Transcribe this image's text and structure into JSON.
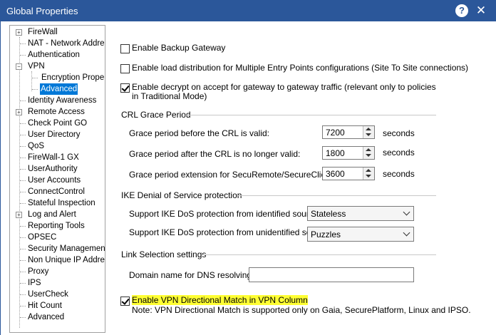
{
  "window": {
    "title": "Global Properties",
    "help_glyph": "?",
    "close_glyph": "✕"
  },
  "tree": {
    "items": [
      {
        "label": "FireWall",
        "expander": "+"
      },
      {
        "label": "NAT - Network Address Translation"
      },
      {
        "label": "Authentication"
      },
      {
        "label": "VPN",
        "expander": "−"
      },
      {
        "label": "Encryption Properties"
      },
      {
        "label": "Advanced",
        "selected": true
      },
      {
        "label": "Identity Awareness"
      },
      {
        "label": "Remote Access",
        "expander": "+"
      },
      {
        "label": "Check Point GO"
      },
      {
        "label": "User Directory"
      },
      {
        "label": "QoS"
      },
      {
        "label": "FireWall-1 GX"
      },
      {
        "label": "UserAuthority"
      },
      {
        "label": "User Accounts"
      },
      {
        "label": "ConnectControl"
      },
      {
        "label": "Stateful Inspection"
      },
      {
        "label": "Log and Alert",
        "expander": "+"
      },
      {
        "label": "Reporting Tools"
      },
      {
        "label": "OPSEC"
      },
      {
        "label": "Security Management Access"
      },
      {
        "label": "Non Unique IP Address Ranges"
      },
      {
        "label": "Proxy"
      },
      {
        "label": "IPS"
      },
      {
        "label": "UserCheck"
      },
      {
        "label": "Hit Count"
      },
      {
        "label": "Advanced"
      }
    ]
  },
  "panel": {
    "backup_gateway": {
      "label": "Enable Backup Gateway",
      "checked": false
    },
    "load_distribution": {
      "label": "Enable load distribution for Multiple Entry Points configurations (Site To Site connections)",
      "checked": false
    },
    "decrypt_accept": {
      "label_line1": "Enable decrypt on accept for gateway to gateway traffic (relevant only to policies",
      "label_line2": "in Traditional Mode)",
      "checked": true
    },
    "crl": {
      "title": "CRL Grace Period",
      "rows": [
        {
          "label": "Grace period before the CRL is valid:",
          "value": "7200",
          "unit": "seconds"
        },
        {
          "label": "Grace period after the CRL is no longer valid:",
          "value": "1800",
          "unit": "seconds"
        },
        {
          "label": "Grace period extension for SecuRemote/SecureClient:",
          "value": "3600",
          "unit": "seconds"
        }
      ]
    },
    "ike": {
      "title": "IKE Denial of Service protection",
      "identified": {
        "label": "Support IKE DoS protection from identified source",
        "value": "Stateless"
      },
      "unidentified": {
        "label": "Support IKE DoS protection from unidentified source",
        "value": "Puzzles"
      }
    },
    "link": {
      "title": "Link Selection settings",
      "dns": {
        "label": "Domain name for DNS resolving:",
        "value": ""
      }
    },
    "vpn_directional": {
      "label": "Enable VPN Directional Match in VPN Column",
      "checked": true,
      "note": "Note: VPN Directional Match is supported only on Gaia, SecurePlatform, Linux and IPSO."
    }
  }
}
